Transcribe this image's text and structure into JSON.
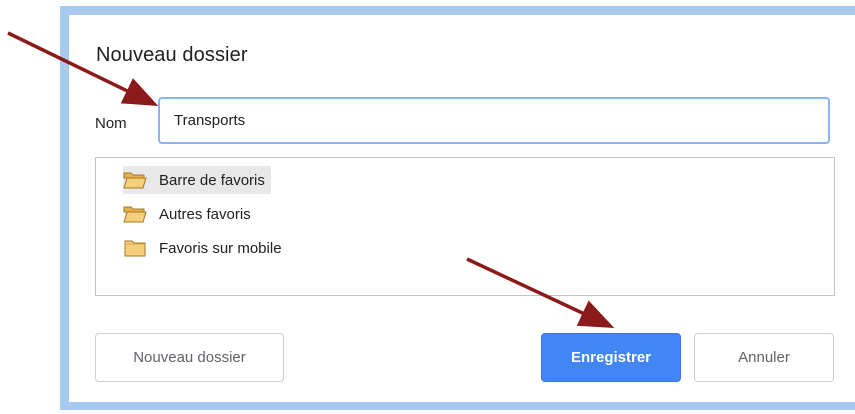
{
  "dialog": {
    "title": "Nouveau dossier",
    "name_label": "Nom",
    "name_value": "Transports"
  },
  "folders": [
    {
      "label": "Barre de favoris",
      "icon": "folder-open-icon",
      "selected": true
    },
    {
      "label": "Autres favoris",
      "icon": "folder-open-icon",
      "selected": false
    },
    {
      "label": "Favoris sur mobile",
      "icon": "folder-closed-icon",
      "selected": false
    }
  ],
  "buttons": {
    "new_folder": "Nouveau dossier",
    "save": "Enregistrer",
    "cancel": "Annuler"
  },
  "colors": {
    "accent": "#4285f4",
    "focus_border": "#8ab4f8",
    "frame": "#a7c9ee",
    "folder": "#f4c264",
    "annotation_arrow": "#8b1a1a"
  }
}
